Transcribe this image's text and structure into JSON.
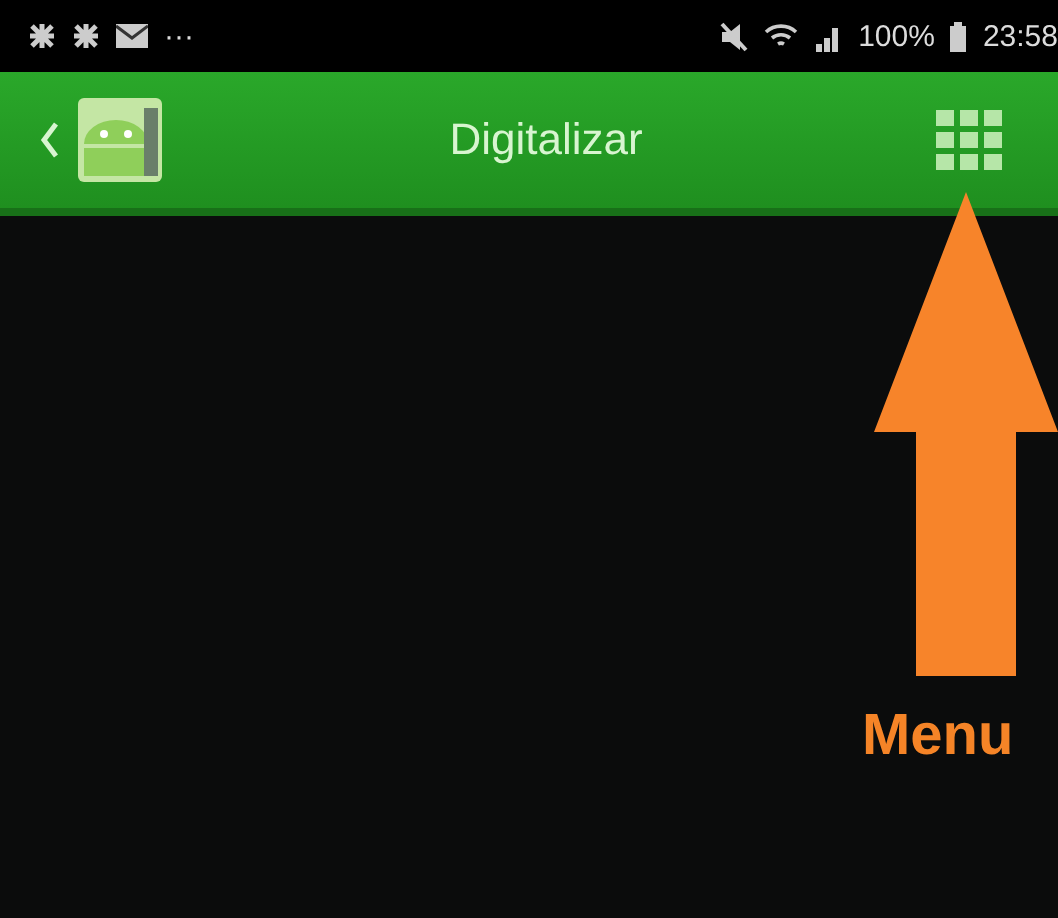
{
  "status_bar": {
    "more": "···",
    "battery_percent": "100%",
    "time": "23:58"
  },
  "app_bar": {
    "title": "Digitalizar"
  },
  "annotation": {
    "label": "Menu"
  }
}
